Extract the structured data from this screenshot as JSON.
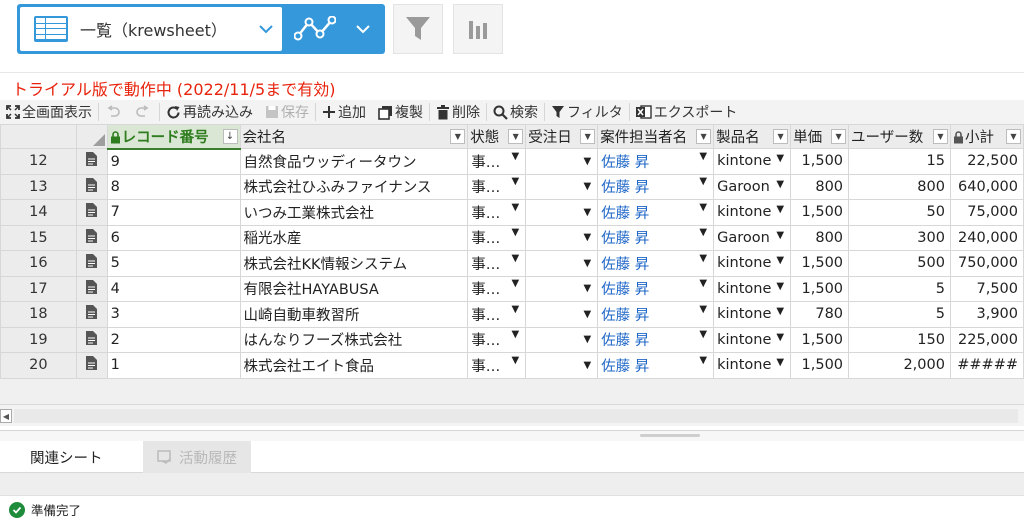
{
  "view": {
    "name": "一覧（krewsheet）"
  },
  "notice": {
    "trial": "トライアル版で動作中 (2022/11/5まで有効)"
  },
  "toolbar": {
    "fullscreen": "全画面表示",
    "reload": "再読み込み",
    "save": "保存",
    "add": "追加",
    "copy": "複製",
    "delete": "削除",
    "search": "検索",
    "filter": "フィルタ",
    "export": "エクスポート"
  },
  "columns": {
    "record_no": "レコード番号",
    "company": "会社名",
    "status": "状態",
    "order_date": "受注日",
    "owner": "案件担当者名",
    "product": "製品名",
    "price": "単価",
    "users": "ユーザー数",
    "subtotal": "小計"
  },
  "rows": [
    {
      "row": "12",
      "record_no": "9",
      "company": "自然食品ウッディータウン",
      "status": "事…",
      "order_date": "",
      "owner": "佐藤 昇",
      "product": "kintone",
      "price": "1,500",
      "users": "15",
      "subtotal": "22,500"
    },
    {
      "row": "13",
      "record_no": "8",
      "company": "株式会社ひふみファイナンス",
      "status": "事…",
      "order_date": "",
      "owner": "佐藤 昇",
      "product": "Garoon",
      "price": "800",
      "users": "800",
      "subtotal": "640,000"
    },
    {
      "row": "14",
      "record_no": "7",
      "company": "いつみ工業株式会社",
      "status": "事…",
      "order_date": "",
      "owner": "佐藤 昇",
      "product": "kintone",
      "price": "1,500",
      "users": "50",
      "subtotal": "75,000"
    },
    {
      "row": "15",
      "record_no": "6",
      "company": "稲光水産",
      "status": "事…",
      "order_date": "",
      "owner": "佐藤 昇",
      "product": "Garoon",
      "price": "800",
      "users": "300",
      "subtotal": "240,000"
    },
    {
      "row": "16",
      "record_no": "5",
      "company": "株式会社KK情報システム",
      "status": "事…",
      "order_date": "",
      "owner": "佐藤 昇",
      "product": "kintone",
      "price": "1,500",
      "users": "500",
      "subtotal": "750,000"
    },
    {
      "row": "17",
      "record_no": "4",
      "company": "有限会社HAYABUSA",
      "status": "事…",
      "order_date": "",
      "owner": "佐藤 昇",
      "product": "kintone",
      "price": "1,500",
      "users": "5",
      "subtotal": "7,500"
    },
    {
      "row": "18",
      "record_no": "3",
      "company": "山崎自動車教習所",
      "status": "事…",
      "order_date": "",
      "owner": "佐藤 昇",
      "product": "kintone",
      "price": "780",
      "users": "5",
      "subtotal": "3,900"
    },
    {
      "row": "19",
      "record_no": "2",
      "company": "はんなりフーズ株式会社",
      "status": "事…",
      "order_date": "",
      "owner": "佐藤 昇",
      "product": "kintone",
      "price": "1,500",
      "users": "150",
      "subtotal": "225,000"
    },
    {
      "row": "20",
      "record_no": "1",
      "company": "株式会社エイト食品",
      "status": "事…",
      "order_date": "",
      "owner": "佐藤 昇",
      "product": "kintone",
      "price": "1,500",
      "users": "2,000",
      "subtotal": "#####"
    }
  ],
  "tabs": {
    "related": "関連シート",
    "activity": "活動履歴"
  },
  "status": {
    "text": "準備完了"
  },
  "colors": {
    "accent": "#3498db",
    "trial": "#e8230d",
    "user_link": "#1f67c7",
    "selected_header": "#2f7d1f"
  }
}
